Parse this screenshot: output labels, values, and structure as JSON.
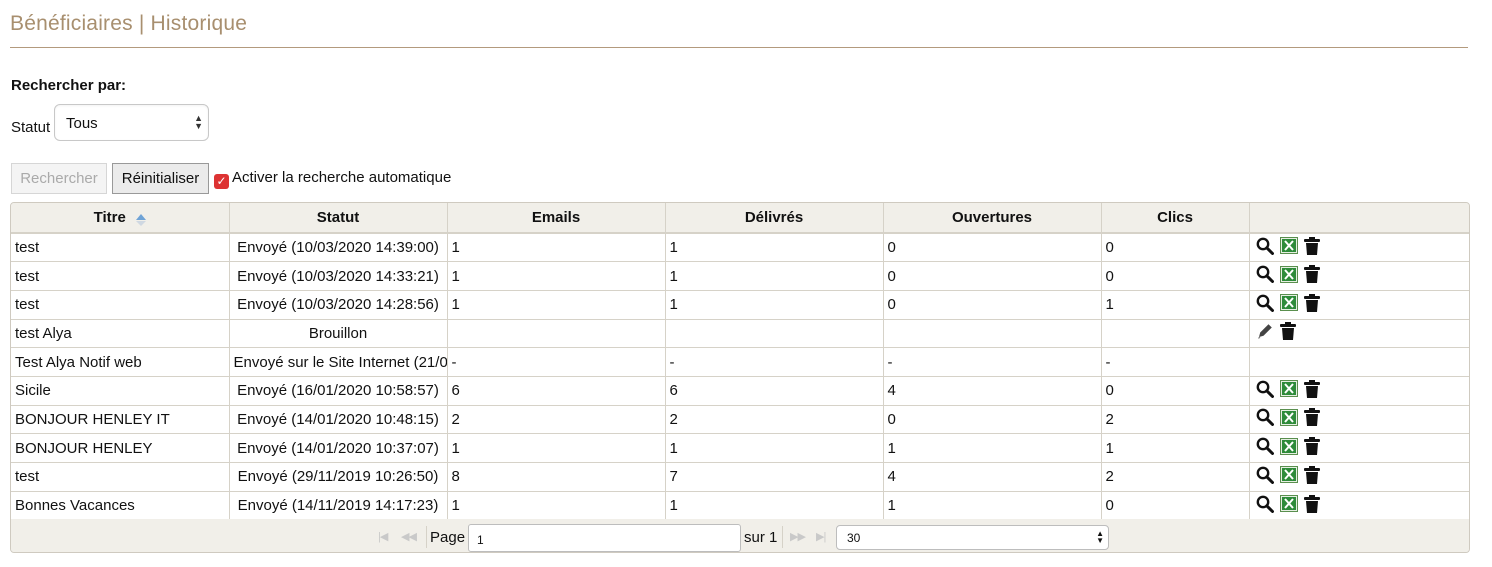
{
  "page": {
    "title": "Bénéficiaires | Historique"
  },
  "search": {
    "heading": "Rechercher par:",
    "status_label": "Statut",
    "status_value": "Tous",
    "search_button": "Rechercher",
    "reset_button": "Réinitialiser",
    "auto_search_label": "Activer la recherche automatique",
    "auto_search_checked": true
  },
  "table": {
    "columns": [
      "Titre",
      "Statut",
      "Emails",
      "Délivrés",
      "Ouvertures",
      "Clics",
      ""
    ],
    "sorted_column": "Titre",
    "rows": [
      {
        "titre": "test",
        "statut": "Envoyé (10/03/2020 14:39:00)",
        "emails": "1",
        "delivres": "1",
        "ouvertures": "0",
        "clics": "0",
        "actions": [
          "search-icon",
          "excel-icon",
          "trash-icon"
        ]
      },
      {
        "titre": "test",
        "statut": "Envoyé (10/03/2020 14:33:21)",
        "emails": "1",
        "delivres": "1",
        "ouvertures": "0",
        "clics": "0",
        "actions": [
          "search-icon",
          "excel-icon",
          "trash-icon"
        ]
      },
      {
        "titre": "test",
        "statut": "Envoyé (10/03/2020 14:28:56)",
        "emails": "1",
        "delivres": "1",
        "ouvertures": "0",
        "clics": "1",
        "actions": [
          "search-icon",
          "excel-icon",
          "trash-icon"
        ]
      },
      {
        "titre": "test Alya",
        "statut": "Brouillon",
        "emails": "",
        "delivres": "",
        "ouvertures": "",
        "clics": "",
        "actions": [
          "pencil-icon",
          "trash-icon"
        ]
      },
      {
        "titre": "Test Alya Notif web",
        "statut": "Envoyé sur le Site Internet (21/0",
        "emails": "-",
        "delivres": "-",
        "ouvertures": "-",
        "clics": "-",
        "actions": []
      },
      {
        "titre": "Sicile",
        "statut": "Envoyé (16/01/2020 10:58:57)",
        "emails": "6",
        "delivres": "6",
        "ouvertures": "4",
        "clics": "0",
        "actions": [
          "search-icon",
          "excel-icon",
          "trash-icon"
        ]
      },
      {
        "titre": "BONJOUR HENLEY IT",
        "statut": "Envoyé (14/01/2020 10:48:15)",
        "emails": "2",
        "delivres": "2",
        "ouvertures": "0",
        "clics": "2",
        "actions": [
          "search-icon",
          "excel-icon",
          "trash-icon"
        ]
      },
      {
        "titre": "BONJOUR HENLEY",
        "statut": "Envoyé (14/01/2020 10:37:07)",
        "emails": "1",
        "delivres": "1",
        "ouvertures": "1",
        "clics": "1",
        "actions": [
          "search-icon",
          "excel-icon",
          "trash-icon"
        ]
      },
      {
        "titre": "test",
        "statut": "Envoyé (29/11/2019 10:26:50)",
        "emails": "8",
        "delivres": "7",
        "ouvertures": "4",
        "clics": "2",
        "actions": [
          "search-icon",
          "excel-icon",
          "trash-icon"
        ]
      },
      {
        "titre": "Bonnes Vacances",
        "statut": "Envoyé (14/11/2019 14:17:23)",
        "emails": "1",
        "delivres": "1",
        "ouvertures": "1",
        "clics": "0",
        "actions": [
          "search-icon",
          "excel-icon",
          "trash-icon"
        ]
      }
    ]
  },
  "pager": {
    "page_label": "Page",
    "page_value": "1",
    "of_label": "sur 1",
    "page_size": "30"
  },
  "colors": {
    "title": "#a88f6f",
    "header_line": "#b39a7d",
    "excel": "#2e8b3a",
    "checkbox": "#d33"
  }
}
